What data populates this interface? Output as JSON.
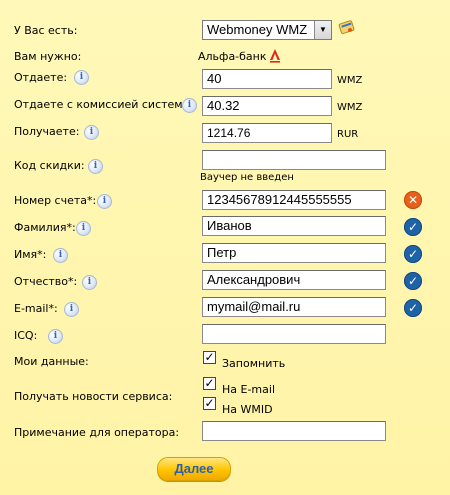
{
  "have": {
    "label": "У Вас есть:",
    "selected": "Webmoney WMZ"
  },
  "need": {
    "label": "Вам нужно:",
    "value": "Альфа-банк"
  },
  "give": {
    "label": "Отдаете:",
    "value": "40",
    "unit": "WMZ"
  },
  "give_fee": {
    "label": "Отдаете с комиссией системы:",
    "value": "40.32",
    "unit": "WMZ"
  },
  "receive": {
    "label": "Получаете:",
    "value": "1214.76",
    "unit": "RUR"
  },
  "discount": {
    "label": "Код скидки:",
    "value": "",
    "hint": "Ваучер не введен"
  },
  "account": {
    "label": "Номер счета*:",
    "value": "12345678912445555555",
    "status": "error"
  },
  "surname": {
    "label": "Фамилия*:",
    "value": "Иванов",
    "status": "ok"
  },
  "name": {
    "label": "Имя*:",
    "value": "Петр",
    "status": "ok"
  },
  "patronymic": {
    "label": "Отчество*:",
    "value": "Александрович",
    "status": "ok"
  },
  "email": {
    "label": "E-mail*:",
    "value": "mymail@mail.ru",
    "status": "ok"
  },
  "icq": {
    "label": "ICQ:",
    "value": ""
  },
  "my_data": {
    "label": "Мои данные:",
    "checkbox_label": "Запомнить",
    "checked": true
  },
  "news": {
    "label": "Получать новости сервиса:",
    "options": [
      {
        "label": "На E-mail",
        "checked": true
      },
      {
        "label": "На WMID",
        "checked": true
      }
    ]
  },
  "note": {
    "label": "Примечание для оператора:",
    "value": ""
  },
  "submit_label": "Далее",
  "info_glyph": "i",
  "status_ok_glyph": "✓",
  "status_err_glyph": "✕",
  "check_glyph": "✓",
  "colors": {
    "ok": "#1e63a8",
    "error": "#e8611c",
    "button": "#ffc400",
    "button_text": "#2d5fb0"
  }
}
